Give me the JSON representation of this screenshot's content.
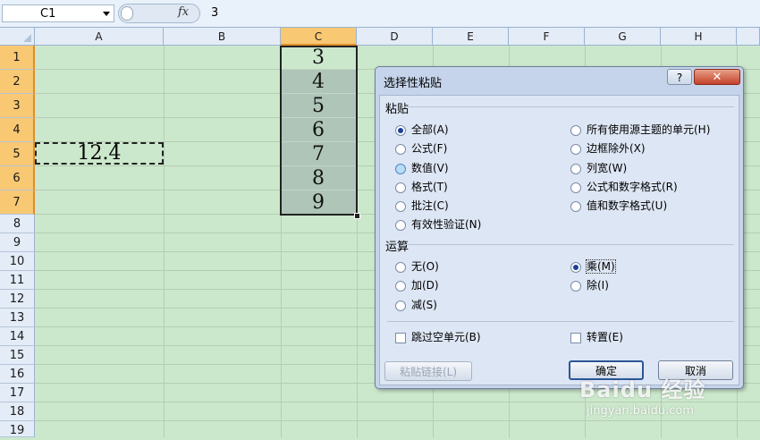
{
  "formula_bar": {
    "name_box": "C1",
    "fx_label": "fx",
    "content": "3"
  },
  "grid": {
    "columns": [
      "A",
      "B",
      "C",
      "D",
      "E",
      "F",
      "G",
      "H"
    ],
    "rows": [
      "1",
      "2",
      "3",
      "4",
      "5",
      "6",
      "7",
      "8",
      "9",
      "10",
      "11",
      "12",
      "13",
      "14",
      "15",
      "16",
      "17",
      "18",
      "19"
    ],
    "column_c_values": [
      "3",
      "4",
      "5",
      "6",
      "7",
      "8",
      "9"
    ],
    "a5_value": "12.4"
  },
  "dialog": {
    "title": "选择性粘贴",
    "help": "?",
    "close": "✕",
    "paste_group": "粘贴",
    "paste_options_left": [
      "全部(A)",
      "公式(F)",
      "数值(V)",
      "格式(T)",
      "批注(C)",
      "有效性验证(N)"
    ],
    "paste_options_right": [
      "所有使用源主题的单元(H)",
      "边框除外(X)",
      "列宽(W)",
      "公式和数字格式(R)",
      "值和数字格式(U)"
    ],
    "operation_group": "运算",
    "operation_left": [
      "无(O)",
      "加(D)",
      "减(S)"
    ],
    "operation_right": [
      "乘(M)",
      "除(I)"
    ],
    "skip_blanks": "跳过空单元(B)",
    "transpose": "转置(E)",
    "paste_link": "粘贴链接(L)",
    "ok": "确定",
    "cancel": "取消",
    "selected_paste": "全部(A)",
    "selected_operation": "乘(M)"
  },
  "watermark": {
    "logo": "Baidu 经验",
    "url": "jingyan.baidu.com"
  }
}
